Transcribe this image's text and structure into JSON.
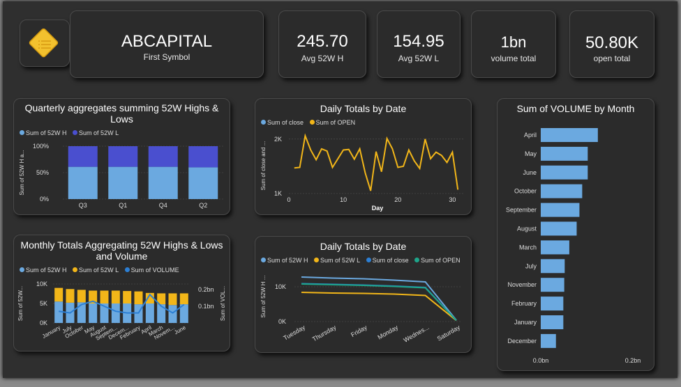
{
  "header": {
    "symbol": "ABCAPITAL",
    "symbol_label": "First Symbol",
    "logo_icon": "list-document-icon"
  },
  "kpis": [
    {
      "value": "245.70",
      "label": "Avg 52W H"
    },
    {
      "value": "154.95",
      "label": "Avg 52W L"
    },
    {
      "value": "1bn",
      "label": "volume total"
    },
    {
      "value": "50.80K",
      "label": "open total"
    }
  ],
  "colors": {
    "light_blue": "#6ba9e0",
    "dark_blue": "#4a4fcf",
    "yellow": "#f2b619",
    "teal": "#1ea58a",
    "volume_line": "#2c7fd4"
  },
  "quarterly": {
    "title": "Quarterly aggregates summing 52W Highs & Lows",
    "legend": [
      "Sum of 52W H",
      "Sum of 52W L"
    ],
    "ylabel": "Sum of 52W H a...",
    "yticks": [
      "100%",
      "50%",
      "0%"
    ],
    "chart_data": {
      "type": "bar",
      "stacking": "100%",
      "categories": [
        "Q3",
        "Q1",
        "Q4",
        "Q2"
      ],
      "series": [
        {
          "name": "Sum of 52W H",
          "values": [
            61,
            61,
            61,
            60
          ]
        },
        {
          "name": "Sum of 52W L",
          "values": [
            39,
            39,
            39,
            40
          ]
        }
      ],
      "ylim": [
        0,
        100
      ]
    }
  },
  "daily1": {
    "title": "Daily Totals by Date",
    "legend": [
      "Sum of close",
      "Sum of OPEN"
    ],
    "ylabel": "Sum of close and ...",
    "xlabel": "Day",
    "yticks": [
      "2K",
      "1K"
    ],
    "xticks": [
      "0",
      "10",
      "20",
      "30"
    ],
    "chart_data": {
      "type": "line",
      "x": [
        1,
        2,
        3,
        4,
        5,
        6,
        7,
        8,
        9,
        10,
        11,
        12,
        13,
        14,
        15,
        16,
        17,
        18,
        19,
        20,
        21,
        22,
        23,
        24,
        25,
        26,
        27,
        28,
        29,
        30,
        31
      ],
      "series": [
        {
          "name": "Sum of OPEN",
          "values": [
            1470,
            1480,
            2060,
            1800,
            1620,
            1820,
            1780,
            1480,
            1640,
            1800,
            1810,
            1630,
            1820,
            1380,
            1050,
            1770,
            1400,
            2010,
            1820,
            1480,
            1500,
            1800,
            1600,
            1460,
            2000,
            1640,
            1760,
            1700,
            1570,
            1760,
            1070
          ]
        }
      ],
      "xlim": [
        0,
        32
      ],
      "ylim": [
        1000,
        2100
      ]
    }
  },
  "volume_by_month": {
    "title": "Sum of VOLUME by Month",
    "xticks": [
      "0.0bn",
      "0.2bn"
    ],
    "chart_data": {
      "type": "bar",
      "orientation": "horizontal",
      "categories": [
        "April",
        "May",
        "June",
        "October",
        "September",
        "August",
        "March",
        "July",
        "November",
        "February",
        "January",
        "December"
      ],
      "values": [
        0.124,
        0.102,
        0.102,
        0.09,
        0.084,
        0.078,
        0.062,
        0.052,
        0.051,
        0.049,
        0.049,
        0.033
      ],
      "xlim": [
        0,
        0.2
      ]
    }
  },
  "monthly": {
    "title": "Monthly Totals Aggregating 52W Highs & Lows and Volume",
    "legend": [
      "Sum of 52W H",
      "Sum of 52W L",
      "Sum of VOLUME"
    ],
    "ylabel_left": "Sum of 52W...",
    "ylabel_right": "Sum of VOL...",
    "yticks_left": [
      "10K",
      "5K",
      "0K"
    ],
    "yticks_right": [
      "0.2bn",
      "0.1bn"
    ],
    "chart_data": {
      "type": "bar",
      "stacking": "stacked",
      "categories": [
        "January",
        "July",
        "October",
        "May",
        "August",
        "Septem...",
        "Decem...",
        "February",
        "April",
        "March",
        "Novem...",
        "June"
      ],
      "series": [
        {
          "name": "Sum of 52W H",
          "values": [
            5500,
            5200,
            5300,
            5000,
            5000,
            5000,
            5000,
            4800,
            5000,
            4800,
            4600,
            4800
          ]
        },
        {
          "name": "Sum of 52W L",
          "values": [
            3500,
            3500,
            3200,
            3300,
            3300,
            3300,
            3200,
            3300,
            2700,
            2800,
            3000,
            2800
          ]
        },
        {
          "name": "Sum of VOLUME",
          "axis": "right",
          "values": [
            0.07,
            0.06,
            0.11,
            0.13,
            0.1,
            0.07,
            0.06,
            0.06,
            0.17,
            0.1,
            0.06,
            0.11
          ]
        }
      ],
      "ylim_left": [
        0,
        10000
      ],
      "ylim_right": [
        0,
        0.25
      ]
    }
  },
  "daily2": {
    "title": "Daily Totals by Date",
    "legend": [
      "Sum of 52W H",
      "Sum of 52W L",
      "Sum of close",
      "Sum of OPEN"
    ],
    "ylabel": "Sum of 52W H ...",
    "yticks": [
      "10K",
      "0K"
    ],
    "chart_data": {
      "type": "line",
      "categories": [
        "Tuesday",
        "Thursday",
        "Friday",
        "Monday",
        "Wednes...",
        "Saturday"
      ],
      "series": [
        {
          "name": "Sum of 52W H",
          "values": [
            12800,
            12500,
            12300,
            11900,
            11400,
            400
          ]
        },
        {
          "name": "Sum of 52W L",
          "values": [
            8400,
            8200,
            8100,
            7900,
            7500,
            300
          ]
        },
        {
          "name": "Sum of close",
          "values": [
            10900,
            10700,
            10500,
            10200,
            9800,
            350
          ]
        },
        {
          "name": "Sum of OPEN",
          "values": [
            10800,
            10600,
            10400,
            10100,
            9700,
            340
          ]
        }
      ],
      "ylim": [
        0,
        14000
      ]
    }
  }
}
